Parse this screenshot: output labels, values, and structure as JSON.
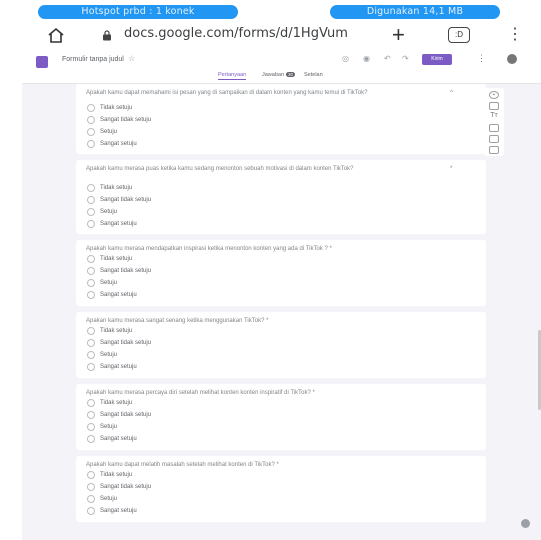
{
  "statusbar": {
    "hotspot": "Hotspot prbd : 1 konek",
    "usage": "Digunakan 14,1 MB"
  },
  "browser": {
    "url": "docs.google.com/forms/d/1HgVum",
    "tabs_count": ":D"
  },
  "app": {
    "form_title": "Formulir tanpa judul",
    "send_label": "Kirim",
    "tabs": [
      {
        "label": "Pertanyaan"
      },
      {
        "label": "Jawaban",
        "badge": "30"
      },
      {
        "label": "Setelan"
      }
    ]
  },
  "sidebar_icons": [
    "add-circle-icon",
    "import-icon",
    "title-icon",
    "image-icon",
    "video-icon",
    "section-icon"
  ],
  "questions": [
    {
      "text": "Apakah kamu dapat memahami isi pesan yang di sampaikan di dalam konten yang kamu temui di TikTok?",
      "options": [
        "Tidak setuju",
        "Sangat tidak setuju",
        "Setuju",
        "Sangat setuju"
      ]
    },
    {
      "text": "Apakah kamu merasa puas ketika kamu sedang menonton sebuah motivasi di dalam konten TikTok?",
      "options": [
        "Tidak setuju",
        "Sangat tidak setuju",
        "Setuju",
        "Sangat setuju"
      ]
    },
    {
      "text": "Apakah kamu merasa mendapatkan inspirasi ketika menonton konten yang ada di TikTok ? *",
      "options": [
        "Tidak setuju",
        "Sangat tidak setuju",
        "Setuju",
        "Sangat setuju"
      ]
    },
    {
      "text": "Apakan kamu merasa sangat senang ketika menggunakan TikTok? *",
      "options": [
        "Tidak setuju",
        "Sangat tidak setuju",
        "Setuju",
        "Sangat setuju"
      ]
    },
    {
      "text": "Apakah kamu merasa percaya diri setelah melihat konten konten inspiratif di TikTok? *",
      "options": [
        "Tidak setuju",
        "Sangat tidak setuju",
        "Setuju",
        "Sangat setuju"
      ]
    },
    {
      "text": "Apakah kamu dapat melatih masalah setelah melihat konten di TikTok? *",
      "options": [
        "Tidak setuju",
        "Sangat tidak setuju",
        "Setuju",
        "Sangat setuju"
      ]
    }
  ]
}
